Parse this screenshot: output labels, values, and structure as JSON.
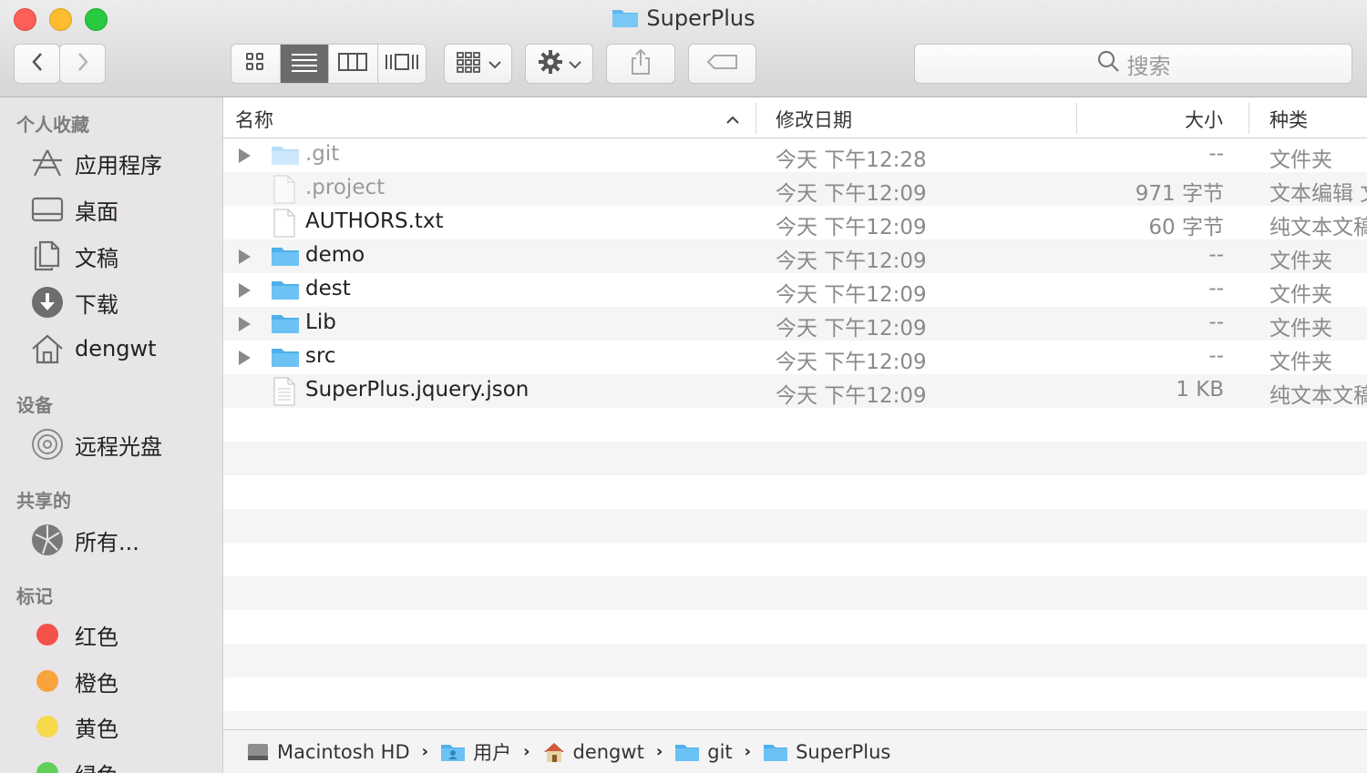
{
  "window": {
    "title": "SuperPlus"
  },
  "toolbar": {
    "search_placeholder": "搜索"
  },
  "sidebar": {
    "favorites_title": "个人收藏",
    "favorites": [
      {
        "label": "应用程序",
        "icon": "applications-icon"
      },
      {
        "label": "桌面",
        "icon": "desktop-icon"
      },
      {
        "label": "文稿",
        "icon": "documents-icon"
      },
      {
        "label": "下载",
        "icon": "downloads-icon"
      },
      {
        "label": "dengwt",
        "icon": "home-icon"
      }
    ],
    "devices_title": "设备",
    "devices": [
      {
        "label": "远程光盘",
        "icon": "disc-icon"
      }
    ],
    "shared_title": "共享的",
    "shared": [
      {
        "label": "所有...",
        "icon": "network-icon"
      }
    ],
    "tags_title": "标记",
    "tags": [
      {
        "label": "红色",
        "color": "#f2524a"
      },
      {
        "label": "橙色",
        "color": "#f8a33c"
      },
      {
        "label": "黄色",
        "color": "#f7d94c"
      },
      {
        "label": "绿色",
        "color": "#5fcf5a"
      }
    ]
  },
  "columns": {
    "name": "名称",
    "date": "修改日期",
    "size": "大小",
    "kind": "种类"
  },
  "files": [
    {
      "name": ".git",
      "date": "今天 下午12:28",
      "size": "--",
      "kind": "文件夹",
      "type": "folder",
      "dim": true
    },
    {
      "name": ".project",
      "date": "今天 下午12:09",
      "size": "971 字节",
      "kind": "文本编辑 文稿",
      "type": "file",
      "dim": true
    },
    {
      "name": "AUTHORS.txt",
      "date": "今天 下午12:09",
      "size": "60 字节",
      "kind": "纯文本文稿",
      "type": "file",
      "dim": false
    },
    {
      "name": "demo",
      "date": "今天 下午12:09",
      "size": "--",
      "kind": "文件夹",
      "type": "folder",
      "dim": false
    },
    {
      "name": "dest",
      "date": "今天 下午12:09",
      "size": "--",
      "kind": "文件夹",
      "type": "folder",
      "dim": false
    },
    {
      "name": "Lib",
      "date": "今天 下午12:09",
      "size": "--",
      "kind": "文件夹",
      "type": "folder",
      "dim": false
    },
    {
      "name": "src",
      "date": "今天 下午12:09",
      "size": "--",
      "kind": "文件夹",
      "type": "folder",
      "dim": false
    },
    {
      "name": "SuperPlus.jquery.json",
      "date": "今天 下午12:09",
      "size": "1 KB",
      "kind": "纯文本文稿",
      "type": "file",
      "dim": false
    }
  ],
  "pathbar": [
    {
      "label": "Macintosh HD",
      "icon": "hard-drive-icon"
    },
    {
      "label": "用户",
      "icon": "users-folder-icon"
    },
    {
      "label": "dengwt",
      "icon": "home-icon"
    },
    {
      "label": "git",
      "icon": "folder-icon"
    },
    {
      "label": "SuperPlus",
      "icon": "folder-icon"
    }
  ]
}
